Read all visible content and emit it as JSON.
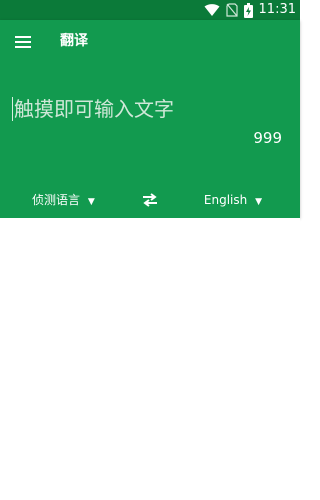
{
  "status_bar": {
    "time": "11:31",
    "wifi_icon": "wifi-icon",
    "sim_icon": "no-sim-icon",
    "battery_icon": "battery-charging-icon",
    "color": "#0b7a39"
  },
  "app_bar": {
    "title": "翻译",
    "menu_icon": "hamburger-menu-icon",
    "color": "#129a4f"
  },
  "input": {
    "placeholder": "触摸即可输入文字",
    "char_limit": "999"
  },
  "languages": {
    "source": "侦测语言",
    "target": "English",
    "swap_icon": "swap-arrows-icon",
    "dropdown_arrow": "▼"
  }
}
